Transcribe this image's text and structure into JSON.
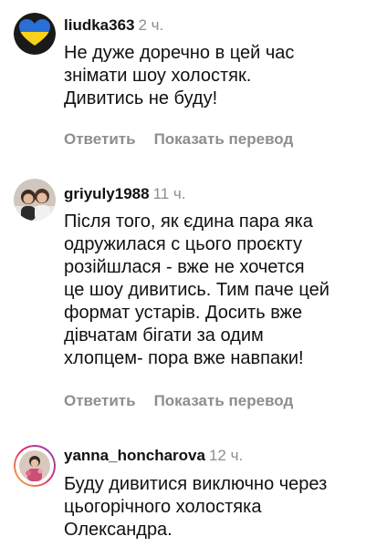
{
  "comments": [
    {
      "username": "liudka363",
      "time": "2 ч.",
      "text": "Не дуже доречно в цей час\nзнімати шоу холостяк.\nДивитись не буду!",
      "reply_label": "Ответить",
      "translate_label": "Показать перевод",
      "avatar_icon": "ukraine-heart-avatar-icon"
    },
    {
      "username": "griyuly1988",
      "time": "11 ч.",
      "text": "Після того, як єдина пара яка\nодружилася с цього проєкту\nрозійшлася - вже не хочется\nце шоу дивитись. Тим паче цей\nформат устарів. Досить вже\nдівчатам бігати за одим\nхлопцем- пора вже навпаки!",
      "reply_label": "Ответить",
      "translate_label": "Показать перевод",
      "avatar_icon": "user-photo-avatar-icon"
    },
    {
      "username": "yanna_honcharova",
      "time": "12 ч.",
      "text": "Буду дивитися виключно через\nцьогорічного холостяка\nОлександра.",
      "reply_label": "",
      "translate_label": "",
      "avatar_icon": "user-photo-avatar-icon",
      "avatar_has_story_ring": true
    }
  ]
}
